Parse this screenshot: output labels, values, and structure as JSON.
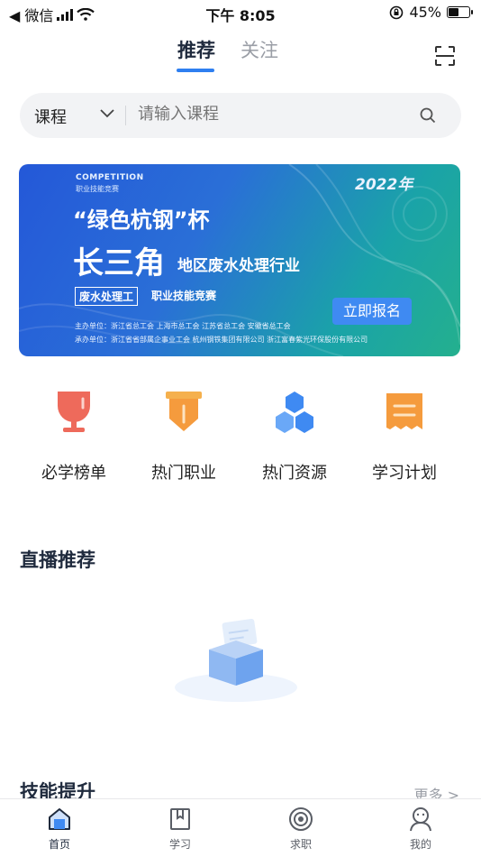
{
  "status_bar": {
    "back_app": "◀ 微信",
    "time": "下午 8:05",
    "battery": "45%",
    "battery_level": 0.45
  },
  "tabs": [
    {
      "label": "推荐",
      "active": true
    },
    {
      "label": "关注",
      "active": false
    }
  ],
  "search": {
    "category": "课程",
    "placeholder": "请输入课程"
  },
  "banner": {
    "competition": "COMPETITION",
    "competition_sub": "职业技能竞赛",
    "year": "2022年",
    "cup": "“绿色杭钢”杯",
    "headline": "长三角",
    "subheadline": "地区废水处理行业",
    "tag": "废水处理工",
    "tag2": "职业技能竞赛",
    "cta": "立即报名",
    "organizers": "主办单位：浙江省总工会    上海市总工会    江苏省总工会    安徽省总工会",
    "co_organizers": "承办单位：浙江省省部属企事业工会    杭州钢铁集团有限公司    浙江富春紫光环保股份有限公司"
  },
  "entries": [
    {
      "label": "必学榜单",
      "icon": "trophy-icon",
      "color": "#ee6a5b"
    },
    {
      "label": "热门职业",
      "icon": "badge-icon",
      "color": "#f59b3d"
    },
    {
      "label": "热门资源",
      "icon": "cubes-icon",
      "color": "#3f8af2"
    },
    {
      "label": "学习计划",
      "icon": "plan-icon",
      "color": "#f59b3d"
    }
  ],
  "sections": {
    "live": "直播推荐",
    "skills": "技能提升",
    "more": "更多 >"
  },
  "nav": [
    {
      "label": "首页",
      "icon": "home-icon",
      "active": true
    },
    {
      "label": "学习",
      "icon": "book-icon",
      "active": false
    },
    {
      "label": "求职",
      "icon": "target-icon",
      "active": false
    },
    {
      "label": "我的",
      "icon": "profile-icon",
      "active": false
    }
  ],
  "colors": {
    "accent": "#2f7ff0",
    "text": "#1f2a3d",
    "muted": "#9a9ea6"
  }
}
